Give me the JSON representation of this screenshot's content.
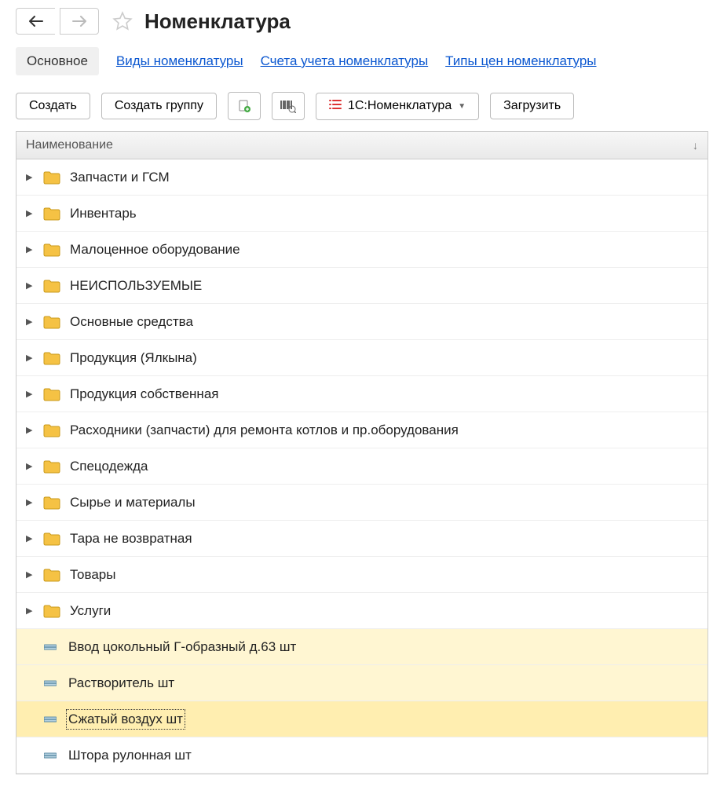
{
  "header": {
    "title": "Номенклатура"
  },
  "tabs": {
    "main": "Основное",
    "links": [
      "Виды номенклатуры",
      "Счета учета номенклатуры",
      "Типы цен номенклатуры"
    ]
  },
  "toolbar": {
    "create": "Создать",
    "create_group": "Создать группу",
    "ref_label": "1С:Номенклатура",
    "load": "Загрузить"
  },
  "table": {
    "column_header": "Наименование",
    "rows": [
      {
        "kind": "folder",
        "label": "Запчасти и ГСМ",
        "highlight": "none"
      },
      {
        "kind": "folder",
        "label": "Инвентарь",
        "highlight": "none"
      },
      {
        "kind": "folder",
        "label": "Малоценное оборудование",
        "highlight": "none"
      },
      {
        "kind": "folder",
        "label": "НЕИСПОЛЬЗУЕМЫЕ",
        "highlight": "none"
      },
      {
        "kind": "folder",
        "label": "Основные средства",
        "highlight": "none"
      },
      {
        "kind": "folder",
        "label": "Продукция (Ялкына)",
        "highlight": "none"
      },
      {
        "kind": "folder",
        "label": "Продукция собственная",
        "highlight": "none"
      },
      {
        "kind": "folder",
        "label": "Расходники (запчасти) для ремонта котлов и пр.оборудования",
        "highlight": "none"
      },
      {
        "kind": "folder",
        "label": "Спецодежда",
        "highlight": "none"
      },
      {
        "kind": "folder",
        "label": "Сырье и материалы",
        "highlight": "none"
      },
      {
        "kind": "folder",
        "label": "Тара не возвратная",
        "highlight": "none"
      },
      {
        "kind": "folder",
        "label": "Товары",
        "highlight": "none"
      },
      {
        "kind": "folder",
        "label": "Услуги",
        "highlight": "none"
      },
      {
        "kind": "item",
        "label": "Ввод цокольный Г-образный д.63 шт",
        "highlight": "light"
      },
      {
        "kind": "item",
        "label": "Растворитель шт",
        "highlight": "light"
      },
      {
        "kind": "item",
        "label": "Сжатый воздух шт",
        "highlight": "strong",
        "selected": true
      },
      {
        "kind": "item",
        "label": "Штора рулонная шт",
        "highlight": "none"
      }
    ]
  }
}
